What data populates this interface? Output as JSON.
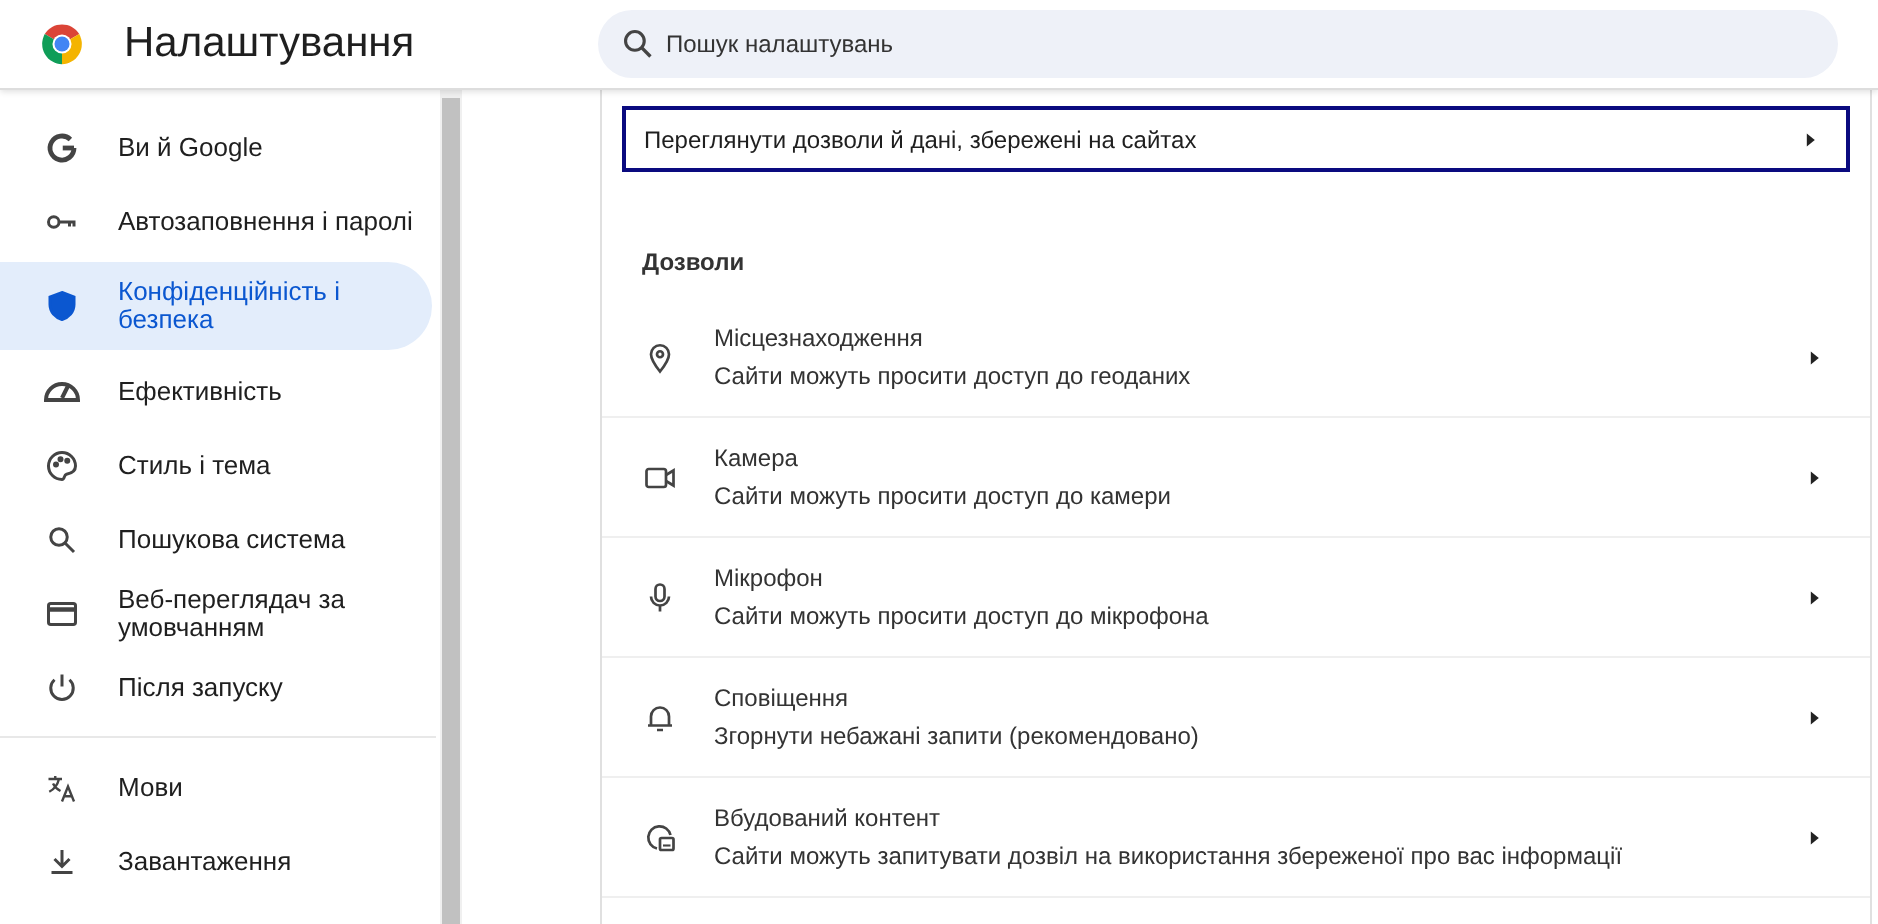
{
  "header": {
    "title": "Налаштування",
    "search": {
      "placeholder": "Пошук налаштувань"
    }
  },
  "sidebar": {
    "groups": [
      {
        "items": [
          {
            "label": "Ви й Google",
            "kind": "google",
            "selected": false
          },
          {
            "label": "Автозаповнення і паролі",
            "kind": "key",
            "selected": false
          },
          {
            "label": "Конфіденційність і безпека",
            "kind": "shield",
            "selected": true
          },
          {
            "label": "Ефективність",
            "kind": "gauge",
            "selected": false
          },
          {
            "label": "Стиль і тема",
            "kind": "palette",
            "selected": false
          },
          {
            "label": "Пошукова система",
            "kind": "search",
            "selected": false
          },
          {
            "label": "Веб-переглядач за умовчанням",
            "kind": "browser",
            "selected": false
          },
          {
            "label": "Після запуску",
            "kind": "power",
            "selected": false
          }
        ]
      },
      {
        "items": [
          {
            "label": "Мови",
            "kind": "translate",
            "selected": false
          },
          {
            "label": "Завантаження",
            "kind": "download",
            "selected": false
          }
        ]
      }
    ]
  },
  "main": {
    "site_data_link": {
      "label": "Переглянути дозволи й дані, збережені на сайтах",
      "focused": true
    },
    "permissions": {
      "heading": "Дозволи",
      "items": [
        {
          "title": "Місцезнаходження",
          "subtitle": "Сайти можуть просити доступ до геоданих",
          "kind": "location"
        },
        {
          "title": "Камера",
          "subtitle": "Сайти можуть просити доступ до камери",
          "kind": "camera"
        },
        {
          "title": "Мікрофон",
          "subtitle": "Сайти можуть просити доступ до мікрофона",
          "kind": "microphone"
        },
        {
          "title": "Сповіщення",
          "subtitle": "Згорнути небажані запити (рекомендовано)",
          "kind": "bell"
        },
        {
          "title": "Вбудований контент",
          "subtitle": "Сайти можуть запитувати дозвіл на використання збереженої про вас інформації",
          "kind": "embed"
        }
      ]
    }
  }
}
